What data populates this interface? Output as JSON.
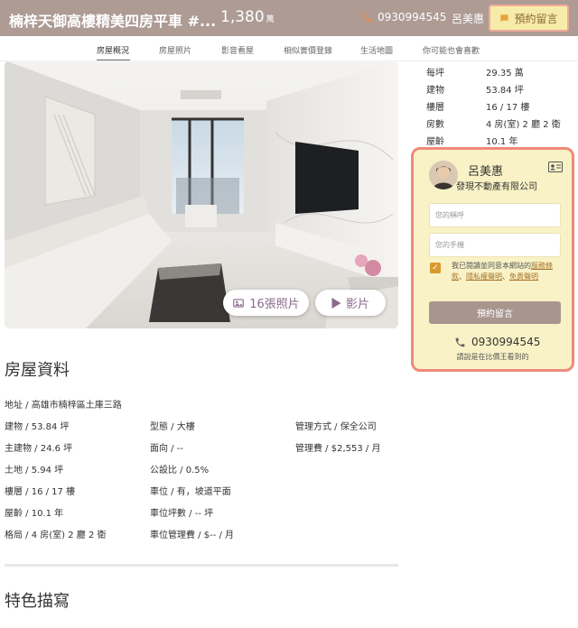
{
  "header": {
    "title": "楠梓天御高樓精美四房平車 #...",
    "price": "1,380",
    "price_unit": "萬",
    "phone": "0930994545",
    "agent": "呂美惠",
    "button_label": "預約留言"
  },
  "tabs": [
    "房屋概況",
    "房屋照片",
    "影音看屋",
    "相似實價登錄",
    "生活地圖",
    "你可能也會喜歡"
  ],
  "photo_buttons": {
    "photos": "16張照片",
    "video": "影片"
  },
  "facts": [
    {
      "label": "每坪",
      "value": "29.35 萬"
    },
    {
      "label": "建物",
      "value": "53.84 坪"
    },
    {
      "label": "樓層",
      "value": "16 / 17 樓"
    },
    {
      "label": "房數",
      "value": "4 房(室) 2 廳 2 衛"
    },
    {
      "label": "屋齡",
      "value": "10.1 年"
    }
  ],
  "contact": {
    "name": "呂美惠",
    "company": "發現不動產有限公司",
    "name_placeholder": "您的稱呼",
    "phone_placeholder": "您的手機",
    "agree_prefix": "我已閱讀並同意本網站的",
    "agree_link1": "服務條款",
    "agree_sep": "、",
    "agree_link2": "隱私權聲明",
    "agree_link3": "免責聲明",
    "submit_label": "預約留言",
    "phone": "0930994545",
    "note": "請說是在比價王看到的"
  },
  "house_info": {
    "title": "房屋資料",
    "address": "地址 / 高雄市楠梓區土庫三路",
    "col1": [
      "建物 / 53.84 坪",
      "主建物 / 24.6 坪",
      "土地 / 5.94 坪",
      "樓層 / 16 / 17 樓",
      "屋齡 / 10.1 年",
      "格局 / 4 房(室) 2 廳 2 衛"
    ],
    "col2": [
      "型態 / 大樓",
      "面向 / --",
      "公設比 / 0.5%",
      "車位 / 有，坡道平面",
      "車位坪數 / -- 坪",
      "車位管理費 / $-- / 月"
    ],
    "col3": [
      "管理方式 / 保全公司",
      "管理費 / $2,553 / 月"
    ]
  },
  "features": {
    "title": "特色描寫"
  }
}
